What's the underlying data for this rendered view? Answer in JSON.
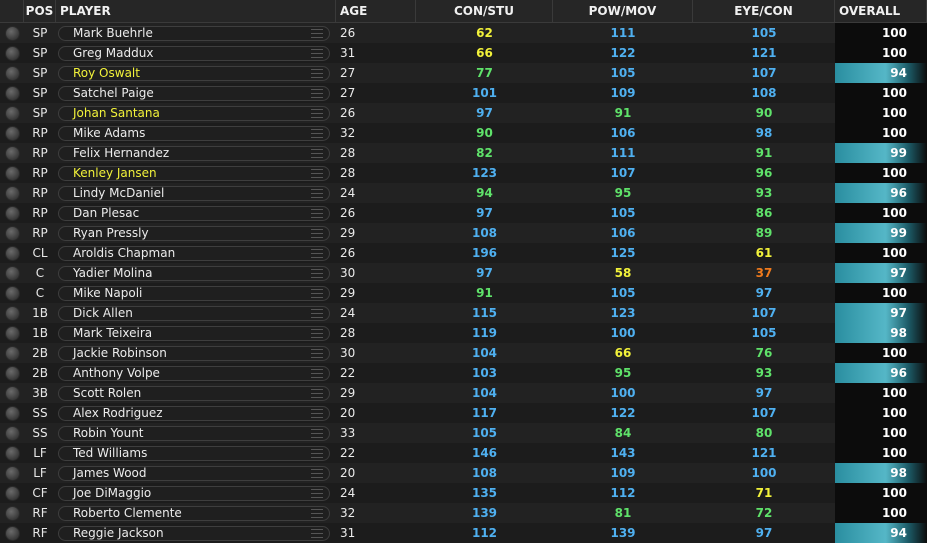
{
  "headers": {
    "pos": "POS",
    "player": "PLAYER",
    "age": "AGE",
    "con_stu": "CON/STU",
    "pow_mov": "POW/MOV",
    "eye_con": "EYE/CON",
    "overall": "OVERALL"
  },
  "colors": {
    "yellow": "#f2f23a",
    "green": "#5fe26a",
    "blue": "#4fb0f0",
    "orange": "#f07a1c",
    "white": "#ffffff"
  },
  "rows": [
    {
      "pos": "SP",
      "name": "Mark Buehrle",
      "hl": false,
      "age": "26",
      "cs": "62",
      "cs_c": "yellow",
      "pm": "111",
      "pm_c": "blue",
      "ec": "105",
      "ec_c": "blue",
      "ov": "100",
      "bar": false
    },
    {
      "pos": "SP",
      "name": "Greg Maddux",
      "hl": false,
      "age": "31",
      "cs": "66",
      "cs_c": "yellow",
      "pm": "122",
      "pm_c": "blue",
      "ec": "121",
      "ec_c": "blue",
      "ov": "100",
      "bar": false
    },
    {
      "pos": "SP",
      "name": "Roy Oswalt",
      "hl": true,
      "age": "27",
      "cs": "77",
      "cs_c": "green",
      "pm": "105",
      "pm_c": "blue",
      "ec": "107",
      "ec_c": "blue",
      "ov": "94",
      "bar": true
    },
    {
      "pos": "SP",
      "name": "Satchel Paige",
      "hl": false,
      "age": "27",
      "cs": "101",
      "cs_c": "blue",
      "pm": "109",
      "pm_c": "blue",
      "ec": "108",
      "ec_c": "blue",
      "ov": "100",
      "bar": false
    },
    {
      "pos": "SP",
      "name": "Johan Santana",
      "hl": true,
      "age": "26",
      "cs": "97",
      "cs_c": "blue",
      "pm": "91",
      "pm_c": "green",
      "ec": "90",
      "ec_c": "green",
      "ov": "100",
      "bar": false
    },
    {
      "pos": "RP",
      "name": "Mike Adams",
      "hl": false,
      "age": "32",
      "cs": "90",
      "cs_c": "green",
      "pm": "106",
      "pm_c": "blue",
      "ec": "98",
      "ec_c": "blue",
      "ov": "100",
      "bar": false
    },
    {
      "pos": "RP",
      "name": "Felix Hernandez",
      "hl": false,
      "age": "28",
      "cs": "82",
      "cs_c": "green",
      "pm": "111",
      "pm_c": "blue",
      "ec": "91",
      "ec_c": "green",
      "ov": "99",
      "bar": true
    },
    {
      "pos": "RP",
      "name": "Kenley Jansen",
      "hl": true,
      "age": "28",
      "cs": "123",
      "cs_c": "blue",
      "pm": "107",
      "pm_c": "blue",
      "ec": "96",
      "ec_c": "green",
      "ov": "100",
      "bar": false
    },
    {
      "pos": "RP",
      "name": "Lindy McDaniel",
      "hl": false,
      "age": "24",
      "cs": "94",
      "cs_c": "green",
      "pm": "95",
      "pm_c": "green",
      "ec": "93",
      "ec_c": "green",
      "ov": "96",
      "bar": true
    },
    {
      "pos": "RP",
      "name": "Dan Plesac",
      "hl": false,
      "age": "26",
      "cs": "97",
      "cs_c": "blue",
      "pm": "105",
      "pm_c": "blue",
      "ec": "86",
      "ec_c": "green",
      "ov": "100",
      "bar": false
    },
    {
      "pos": "RP",
      "name": "Ryan Pressly",
      "hl": false,
      "age": "29",
      "cs": "108",
      "cs_c": "blue",
      "pm": "106",
      "pm_c": "blue",
      "ec": "89",
      "ec_c": "green",
      "ov": "99",
      "bar": true
    },
    {
      "pos": "CL",
      "name": "Aroldis Chapman",
      "hl": false,
      "age": "26",
      "cs": "196",
      "cs_c": "blue",
      "pm": "125",
      "pm_c": "blue",
      "ec": "61",
      "ec_c": "yellow",
      "ov": "100",
      "bar": false
    },
    {
      "pos": "C",
      "name": "Yadier Molina",
      "hl": false,
      "age": "30",
      "cs": "97",
      "cs_c": "blue",
      "pm": "58",
      "pm_c": "yellow",
      "ec": "37",
      "ec_c": "orange",
      "ov": "97",
      "bar": true
    },
    {
      "pos": "C",
      "name": "Mike Napoli",
      "hl": false,
      "age": "29",
      "cs": "91",
      "cs_c": "green",
      "pm": "105",
      "pm_c": "blue",
      "ec": "97",
      "ec_c": "blue",
      "ov": "100",
      "bar": false
    },
    {
      "pos": "1B",
      "name": "Dick Allen",
      "hl": false,
      "age": "24",
      "cs": "115",
      "cs_c": "blue",
      "pm": "123",
      "pm_c": "blue",
      "ec": "107",
      "ec_c": "blue",
      "ov": "97",
      "bar": true
    },
    {
      "pos": "1B",
      "name": "Mark Teixeira",
      "hl": false,
      "age": "28",
      "cs": "119",
      "cs_c": "blue",
      "pm": "100",
      "pm_c": "blue",
      "ec": "105",
      "ec_c": "blue",
      "ov": "98",
      "bar": true
    },
    {
      "pos": "2B",
      "name": "Jackie Robinson",
      "hl": false,
      "age": "30",
      "cs": "104",
      "cs_c": "blue",
      "pm": "66",
      "pm_c": "yellow",
      "ec": "76",
      "ec_c": "green",
      "ov": "100",
      "bar": false
    },
    {
      "pos": "2B",
      "name": "Anthony Volpe",
      "hl": false,
      "age": "22",
      "cs": "103",
      "cs_c": "blue",
      "pm": "95",
      "pm_c": "green",
      "ec": "93",
      "ec_c": "green",
      "ov": "96",
      "bar": true
    },
    {
      "pos": "3B",
      "name": "Scott Rolen",
      "hl": false,
      "age": "29",
      "cs": "104",
      "cs_c": "blue",
      "pm": "100",
      "pm_c": "blue",
      "ec": "97",
      "ec_c": "blue",
      "ov": "100",
      "bar": false
    },
    {
      "pos": "SS",
      "name": "Alex Rodriguez",
      "hl": false,
      "age": "20",
      "cs": "117",
      "cs_c": "blue",
      "pm": "122",
      "pm_c": "blue",
      "ec": "107",
      "ec_c": "blue",
      "ov": "100",
      "bar": false
    },
    {
      "pos": "SS",
      "name": "Robin Yount",
      "hl": false,
      "age": "33",
      "cs": "105",
      "cs_c": "blue",
      "pm": "84",
      "pm_c": "green",
      "ec": "80",
      "ec_c": "green",
      "ov": "100",
      "bar": false
    },
    {
      "pos": "LF",
      "name": "Ted Williams",
      "hl": false,
      "age": "22",
      "cs": "146",
      "cs_c": "blue",
      "pm": "143",
      "pm_c": "blue",
      "ec": "121",
      "ec_c": "blue",
      "ov": "100",
      "bar": false
    },
    {
      "pos": "LF",
      "name": "James Wood",
      "hl": false,
      "age": "20",
      "cs": "108",
      "cs_c": "blue",
      "pm": "109",
      "pm_c": "blue",
      "ec": "100",
      "ec_c": "blue",
      "ov": "98",
      "bar": true
    },
    {
      "pos": "CF",
      "name": "Joe DiMaggio",
      "hl": false,
      "age": "24",
      "cs": "135",
      "cs_c": "blue",
      "pm": "112",
      "pm_c": "blue",
      "ec": "71",
      "ec_c": "yellow",
      "ov": "100",
      "bar": false
    },
    {
      "pos": "RF",
      "name": "Roberto Clemente",
      "hl": false,
      "age": "32",
      "cs": "139",
      "cs_c": "blue",
      "pm": "81",
      "pm_c": "green",
      "ec": "72",
      "ec_c": "green",
      "ov": "100",
      "bar": false
    },
    {
      "pos": "RF",
      "name": "Reggie Jackson",
      "hl": false,
      "age": "31",
      "cs": "112",
      "cs_c": "blue",
      "pm": "139",
      "pm_c": "blue",
      "ec": "97",
      "ec_c": "blue",
      "ov": "94",
      "bar": true
    }
  ]
}
